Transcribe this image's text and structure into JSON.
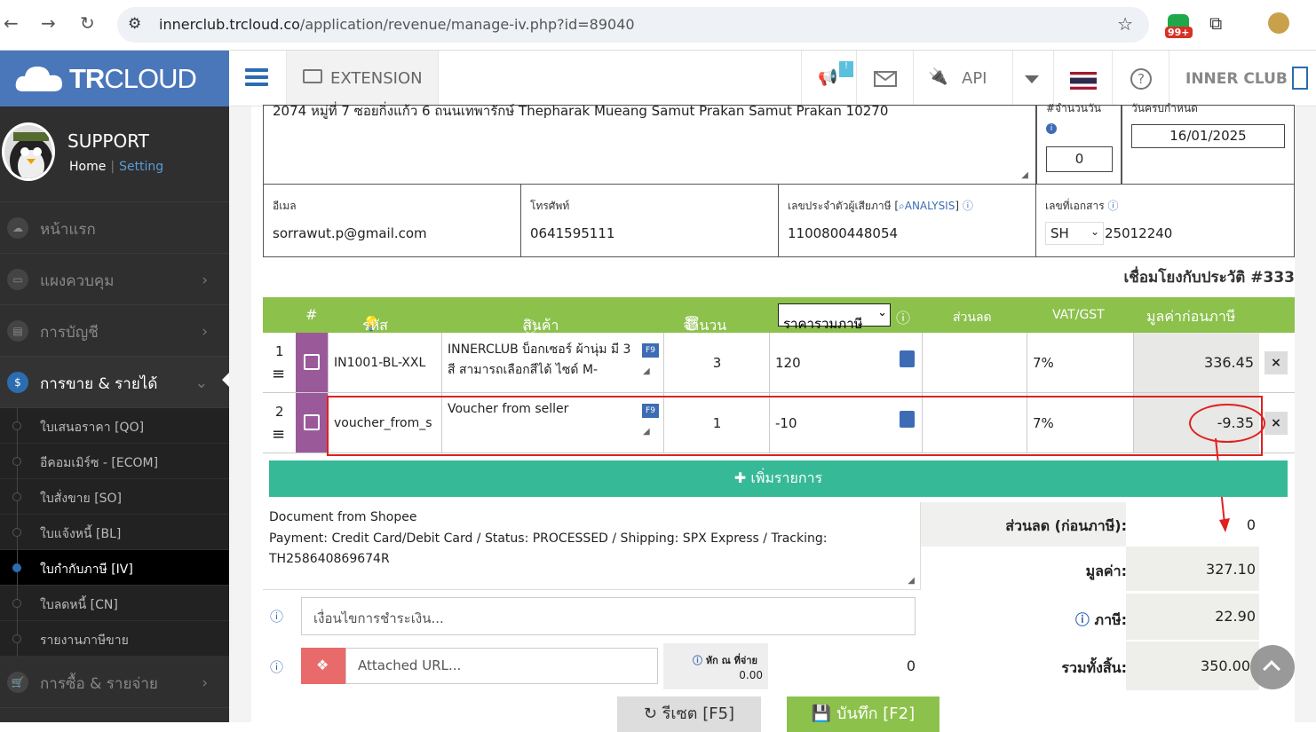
{
  "browser": {
    "url_host": "innerclub.trcloud.co",
    "url_path": "/application/revenue/manage-iv.php?id=89040",
    "ext_badge": "99+"
  },
  "sidebar": {
    "brand_bold": "TR",
    "brand_rest": "CLOUD",
    "user_name": "SUPPORT",
    "home_link": "Home",
    "setting_link": "Setting",
    "menu": [
      {
        "label": "หน้าแรก"
      },
      {
        "label": "แผงควบคุม"
      },
      {
        "label": "การบัญชี"
      },
      {
        "label": "การขาย & รายได้"
      }
    ],
    "submenu": [
      {
        "label": "ใบเสนอราคา [QO]"
      },
      {
        "label": "อีคอมเมิร์ซ - [ECOM]"
      },
      {
        "label": "ใบสั่งขาย [SO]"
      },
      {
        "label": "ใบแจ้งหนี้ [BL]"
      },
      {
        "label": "ใบกำกับภาษี [IV]"
      },
      {
        "label": "ใบลดหนี้ [CN]"
      },
      {
        "label": "รายงานภาษีขาย"
      }
    ],
    "menu_bottom": {
      "label": "การซื้อ & รายจ่าย"
    }
  },
  "topbar": {
    "extension": "EXTENSION",
    "api": "API",
    "inner_club": "INNER CLUB",
    "notif_badge": "!"
  },
  "form": {
    "address": "2074 หมู่ที่ 7 ซอยกิ่งแก้ว 6 ถนนเทพารักษ์ Thepharak Mueang Samut Prakan Samut Prakan 10270",
    "credit_label": "#จำนวนวัน",
    "credit_value": "0",
    "due_label": "วันครบกำหนด",
    "due_value": "16/01/2025",
    "email_label": "อีเมล",
    "email_value": "sorrawut.p@gmail.com",
    "phone_label": "โทรศัพท์",
    "phone_value": "0641595111",
    "taxid_label": "เลขประจำตัวผู้เสียภาษี [",
    "taxid_analysis": "ANALYSIS",
    "taxid_label_end": "]",
    "taxid_value": "1100800448054",
    "docno_label": "เลขที่เอกสาร",
    "docno_prefix": "SH",
    "docno_value": "25012240",
    "history_link": "เชื่อมโยงกับประวัติ #333"
  },
  "table": {
    "headers": {
      "num": "#",
      "code": "รหัส",
      "product": "สินค้า",
      "qty": "จำนวน",
      "price_select": "ราคารวมภาษี",
      "discount": "ส่วนลด",
      "vat": "VAT/GST",
      "amount": "มูลค่าก่อนภาษี"
    },
    "rows": [
      {
        "num": "1",
        "code": "IN1001-BL-XXL",
        "product": "INNERCLUB บ็อกเซอร์ ผ้านุ่ม มี 3 สี สามารถเลือกสีได้ ไซด์ M-",
        "qty": "3",
        "price": "120",
        "vat": "7%",
        "amount": "336.45"
      },
      {
        "num": "2",
        "code": "voucher_from_s",
        "product": "Voucher from seller",
        "qty": "1",
        "price": "-10",
        "vat": "7%",
        "amount": "-9.35"
      }
    ],
    "f9": "F9",
    "remove": "×"
  },
  "add_item": "เพิ่มรายการ",
  "notes": "Document from Shopee\nPayment: Credit Card/Debit Card / Status: PROCESSED / Shipping: SPX Express / Tracking: TH258640869674R",
  "payment_terms_placeholder": "เงื่อนไขการชำระเงิน...",
  "attached_placeholder": "Attached URL...",
  "withholding": {
    "label": "หัก ณ ที่จ่าย",
    "pct": "0.00",
    "value": "0"
  },
  "summary": {
    "discount_label": "ส่วนลด (ก่อนภาษี):",
    "discount_value": "0",
    "value_label": "มูลค่า:",
    "value_value": "327.10",
    "tax_label": "ภาษี:",
    "tax_value": "22.90",
    "total_label": "รวมทั้งสิ้น:",
    "total_value": "350.00"
  },
  "buttons": {
    "reset": "รีเซต [F5]",
    "save": "บันทึก [F2]"
  },
  "colors": {
    "brand_blue": "#4a77ba",
    "header_green": "#8cc14c",
    "add_teal": "#36b997",
    "highlight_red": "#e02020"
  }
}
